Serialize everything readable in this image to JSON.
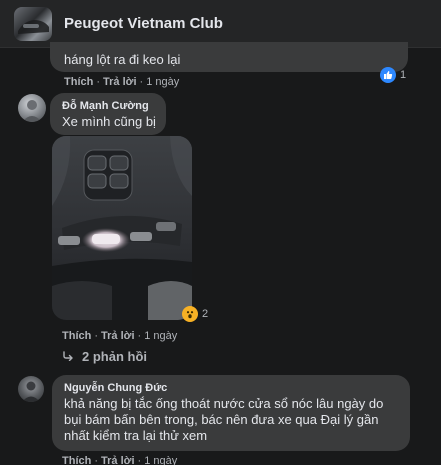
{
  "header": {
    "group_name": "Peugeot Vietnam Club"
  },
  "comment1": {
    "text": "háng lột ra đi keo lại",
    "like_label": "Thích",
    "reply_label": "Trả lời",
    "time": "1 ngày",
    "reaction_count": "1"
  },
  "comment2": {
    "author": "Đỗ Mạnh Cường",
    "text": "Xe mình cũng bị",
    "like_label": "Thích",
    "reply_label": "Trả lời",
    "time": "1 ngày",
    "reaction_count": "2",
    "replies_label": "2 phản hồi"
  },
  "comment3": {
    "author": "Nguyễn Chung Đức",
    "lines": [
      "khả năng bị tắc ống thoát nước cửa sổ nóc lâu ngày do",
      "bụi bám bấn bên trong, bác nên đưa xe qua Đại lý gần",
      "nhất kiểm tra lại thử xem"
    ],
    "like_label": "Thích",
    "reply_label": "Trả lời",
    "time": "1 ngày"
  },
  "colors": {
    "background": "#18191a",
    "bubble": "#3a3b3c",
    "like_blue": "#2d88ff",
    "wow_yellow": "#f7b125"
  },
  "icons": [
    "like-reaction-icon",
    "wow-reaction-icon",
    "reply-arrow-icon"
  ]
}
